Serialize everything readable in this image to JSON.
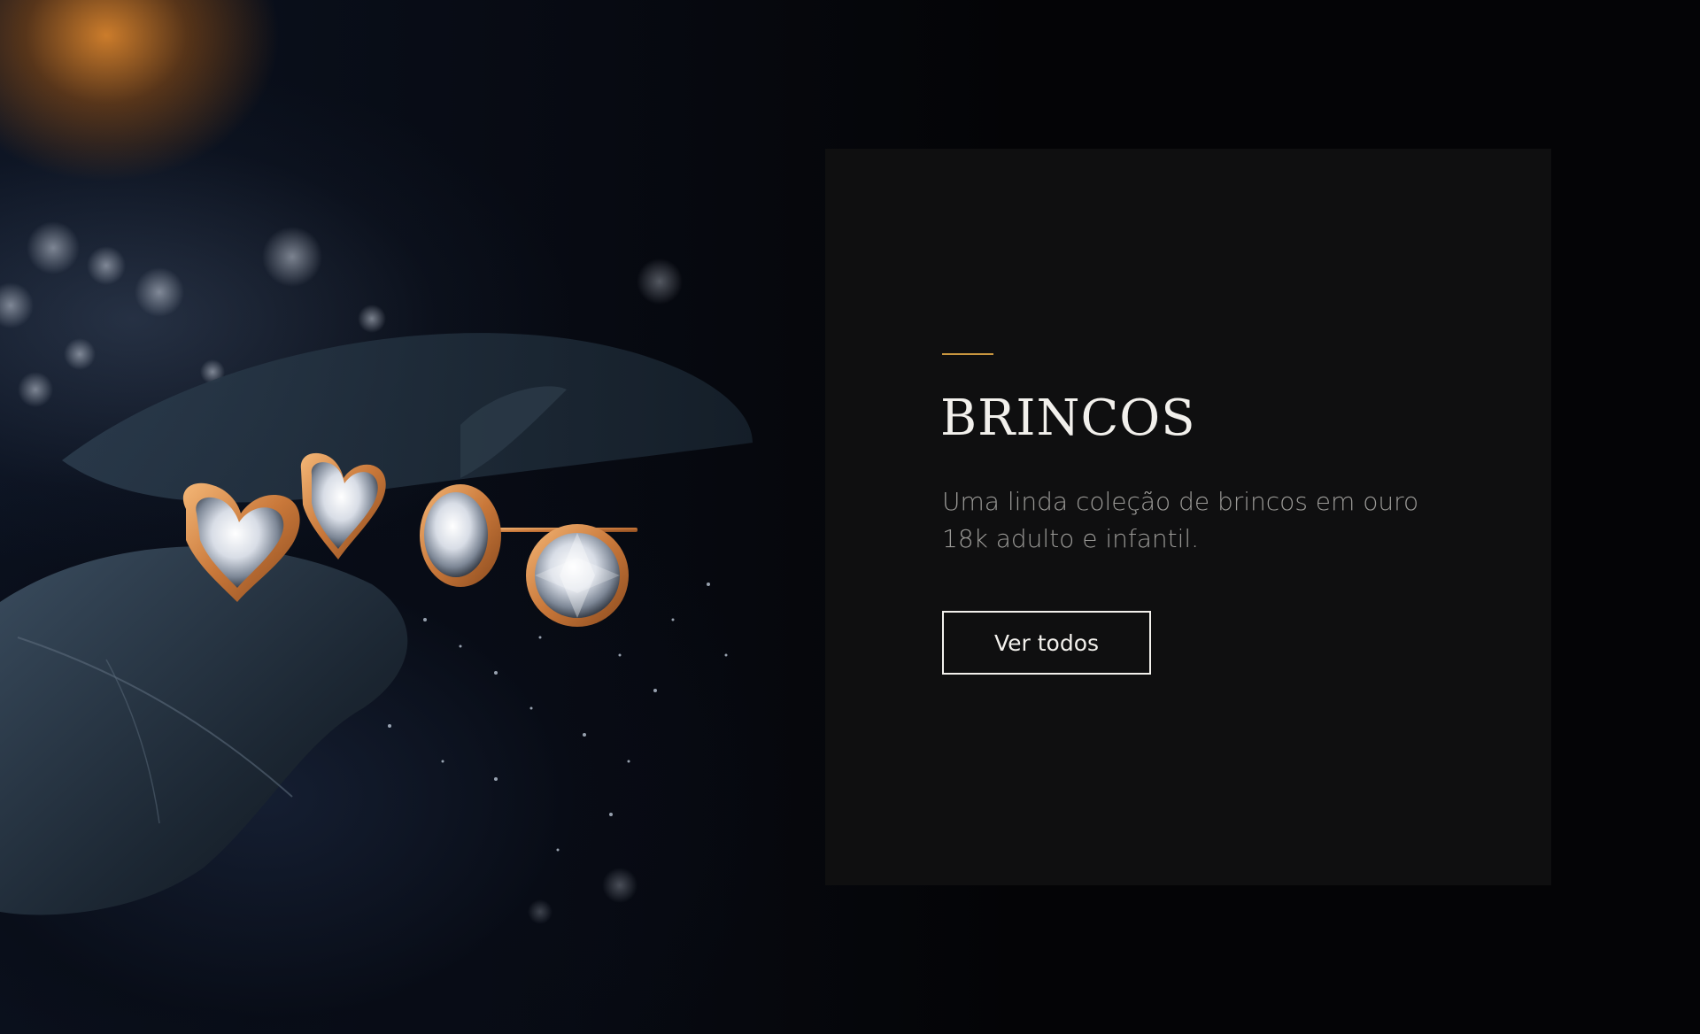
{
  "hero": {
    "image_subject": "diamond-earrings-photo"
  },
  "category_card": {
    "title": "BRINCOS",
    "description": "Uma linda coleção de brincos em ouro 18k adulto e infantil.",
    "cta_label": "Ver todos",
    "colors": {
      "card_background": "#0f0f10",
      "accent_line": "#c9963f",
      "title_text": "#f2f0ec",
      "description_text": "#9a9996",
      "button_border": "#f2f0ec"
    }
  }
}
